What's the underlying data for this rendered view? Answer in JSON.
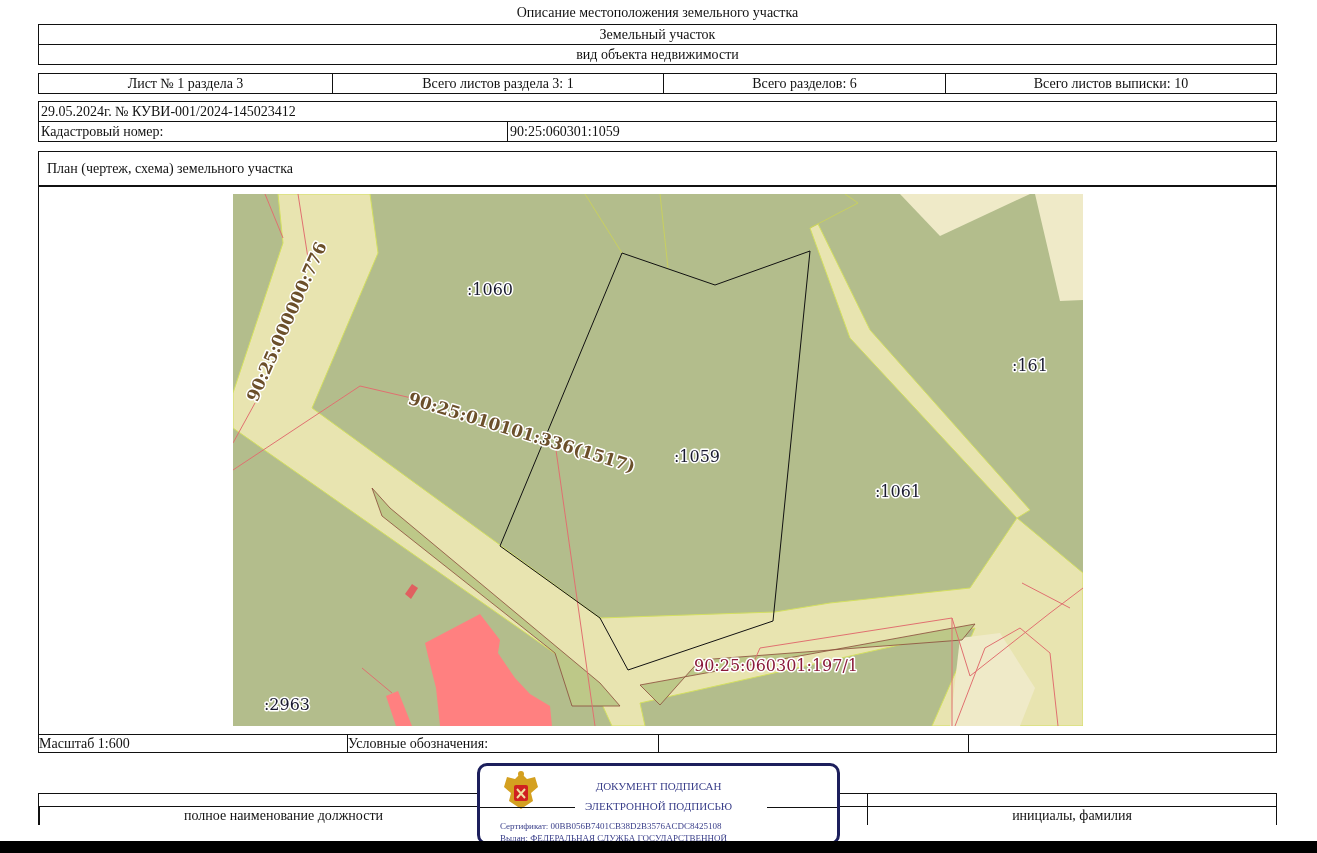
{
  "document_title": "Описание местоположения земельного участка",
  "object": {
    "name": "Земельный участок",
    "caption": "вид объекта недвижимости"
  },
  "sheet_info": [
    "Лист № 1 раздела 3",
    "Всего листов раздела 3: 1",
    "Всего разделов: 6",
    "Всего листов выписки: 10"
  ],
  "statement": "29.05.2024г. № КУВИ-001/2024-145023412",
  "cadastral": {
    "label": "Кадастровый номер:",
    "value": "90:25:060301:1059"
  },
  "plan": {
    "title": "План (чертеж, схема) земельного участка",
    "map_labels": [
      {
        "text": "90:25:000000:776",
        "kind": "boundary"
      },
      {
        "text": ":1060",
        "kind": "parcel"
      },
      {
        "text": "90:25:010101:336(1517)",
        "kind": "boundary"
      },
      {
        "text": ":1059",
        "kind": "parcel"
      },
      {
        "text": ":161",
        "kind": "parcel"
      },
      {
        "text": ":1061",
        "kind": "parcel"
      },
      {
        "text": "90:25:060301:197/1",
        "kind": "zone"
      },
      {
        "text": ":2963",
        "kind": "parcel"
      }
    ]
  },
  "scale": "Масштаб 1:600",
  "legend_label": "Условные обозначения:",
  "stamp": {
    "lines": [
      "ДОКУМЕНТ ПОДПИСАН",
      "ЭЛЕКТРОННОЙ ПОДПИСЬЮ"
    ],
    "certificate": "Сертификат: 00BB056B7401CB38D2B3576ACDC8425108",
    "issuer": "Выдан: ФЕДЕРАЛЬНАЯ СЛУЖБА ГОСУДАРСТВЕННОЙ"
  },
  "signature": {
    "position_caption": "полное наименование должности",
    "name_caption": "инициалы, фамилия"
  }
}
